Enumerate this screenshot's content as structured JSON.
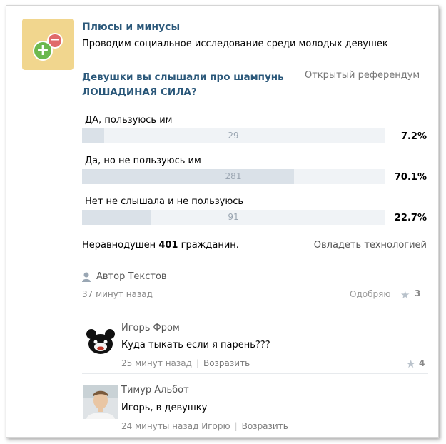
{
  "group": {
    "name": "Плюсы и минусы",
    "description": "Проводим социальное исследование среди молодых девушек"
  },
  "poll": {
    "question": "Девушки вы слышали про шампунь ЛОШАДИНАЯ СИЛА?",
    "type": "Открытый референдум",
    "options": [
      {
        "label": "ДА, пользуюсь им",
        "count": "29",
        "percent": "7.2%",
        "fraction": 0.072
      },
      {
        "label": "Да, но не пользуюсь им",
        "count": "281",
        "percent": "70.1%",
        "fraction": 0.701
      },
      {
        "label": "Нет не слышала и не пользуюсь",
        "count": "91",
        "percent": "22.7%",
        "fraction": 0.227
      }
    ],
    "voters_prefix": "Неравнодушен",
    "voters_count": "401",
    "voters_suffix": "гражданин.",
    "tech_link": "Овладеть технологией"
  },
  "post": {
    "author": "Автор Текстов",
    "time": "37 минут назад",
    "like_label": "Одобряю",
    "like_count": "3"
  },
  "comments": [
    {
      "name": "Игорь Фром",
      "text": "Куда тыкать если я парень???",
      "time": "25 минут назад",
      "reply": "Возразить",
      "like_count": "4"
    },
    {
      "name": "Тимур Альбот",
      "text": "Игорь, в девушку",
      "time": "24 минуты назад Игорю",
      "reply": "Возразить"
    }
  ],
  "icons": {
    "author": "person-icon",
    "like": "star-icon"
  },
  "colors": {
    "link": "#2b587a",
    "bar_bg": "#f0f3f6",
    "bar_fill": "#dae1e8",
    "logo_bg": "#f1d68e",
    "plus": "#6cb84e",
    "minus": "#e06a6a"
  }
}
